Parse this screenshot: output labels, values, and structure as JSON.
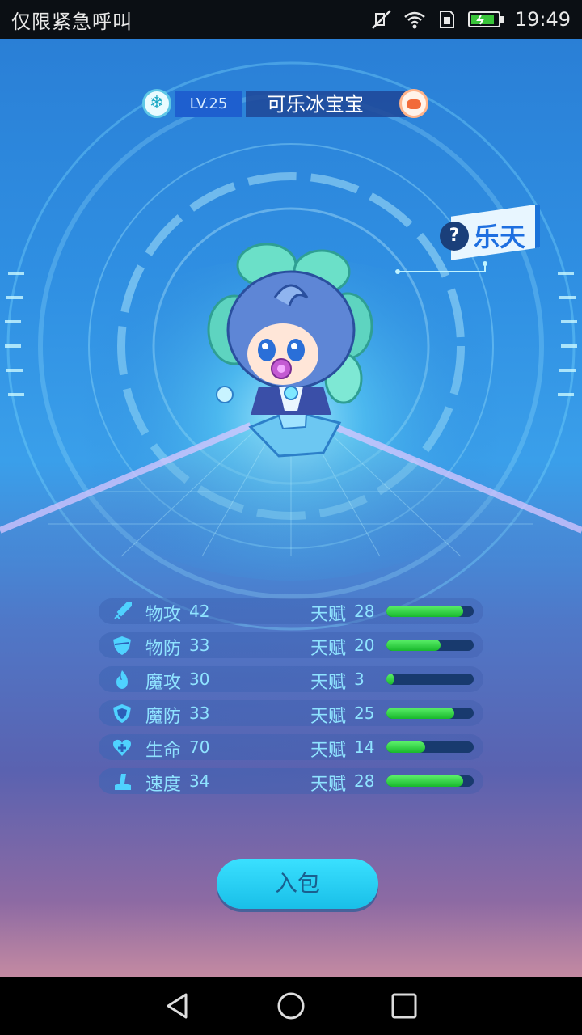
{
  "status_bar": {
    "carrier": "仅限紧急呼叫",
    "time": "19:49",
    "icons": [
      "no-sound-icon",
      "wifi-icon",
      "sim-icon",
      "battery-icon"
    ]
  },
  "pet": {
    "level": "LV.25",
    "name": "可乐冰宝宝",
    "element_icon": "snowflake-icon",
    "tag": "乐天",
    "tag_prefix": "?"
  },
  "stats": [
    {
      "label": "物攻",
      "value": "42",
      "talent_label": "天赋",
      "talent": "28",
      "talent_fraction": 0.88,
      "icon": "sword-icon"
    },
    {
      "label": "物防",
      "value": "33",
      "talent_label": "天赋",
      "talent": "20",
      "talent_fraction": 0.62,
      "icon": "shield-icon"
    },
    {
      "label": "魔攻",
      "value": "30",
      "talent_label": "天赋",
      "talent": "3",
      "talent_fraction": 0.08,
      "icon": "flame-icon"
    },
    {
      "label": "魔防",
      "value": "33",
      "talent_label": "天赋",
      "talent": "25",
      "talent_fraction": 0.78,
      "icon": "magic-shield-icon"
    },
    {
      "label": "生命",
      "value": "70",
      "talent_label": "天赋",
      "talent": "14",
      "talent_fraction": 0.44,
      "icon": "heart-icon"
    },
    {
      "label": "速度",
      "value": "34",
      "talent_label": "天赋",
      "talent": "28",
      "talent_fraction": 0.88,
      "icon": "boot-icon"
    }
  ],
  "actions": {
    "bag_button": "入包"
  },
  "colors": {
    "accent": "#22d3f5",
    "stat_text": "#8fe3ff",
    "bar_fill": "#2ad23e",
    "bar_track": "#183a6e"
  }
}
